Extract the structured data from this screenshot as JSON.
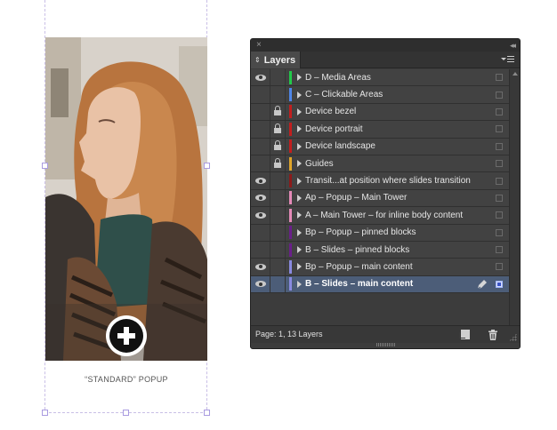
{
  "mockup": {
    "caption": "“STANDARD” POPUP",
    "button_icon": "plus-circle-icon"
  },
  "panel": {
    "close_icon": "×",
    "collapse_icon": "◂◂",
    "tab_label": "Layers",
    "status": "Page: 1, 13 Layers",
    "layers": [
      {
        "name": "D – Media Areas",
        "visible": true,
        "locked": false,
        "color": "#22c94a",
        "selected": false
      },
      {
        "name": "C – Clickable Areas",
        "visible": false,
        "locked": false,
        "color": "#4f86e8",
        "selected": false
      },
      {
        "name": "Device bezel",
        "visible": false,
        "locked": true,
        "color": "#c21e1e",
        "selected": false
      },
      {
        "name": "Device portrait",
        "visible": false,
        "locked": true,
        "color": "#c21e1e",
        "selected": false
      },
      {
        "name": "Device landscape",
        "visible": false,
        "locked": true,
        "color": "#c21e1e",
        "selected": false
      },
      {
        "name": "Guides",
        "visible": false,
        "locked": true,
        "color": "#e0a52a",
        "selected": false
      },
      {
        "name": "Transit...at position where slides transition",
        "visible": true,
        "locked": false,
        "color": "#8c1a1a",
        "selected": false
      },
      {
        "name": "Ap – Popup – Main Tower",
        "visible": true,
        "locked": false,
        "color": "#e58ab8",
        "selected": false
      },
      {
        "name": "A – Main Tower – for inline body content",
        "visible": true,
        "locked": false,
        "color": "#e58ab8",
        "selected": false
      },
      {
        "name": "Bp – Popup – pinned blocks",
        "visible": false,
        "locked": false,
        "color": "#6a1f8a",
        "selected": false
      },
      {
        "name": "B – Slides – pinned blocks",
        "visible": false,
        "locked": false,
        "color": "#6a1f8a",
        "selected": false
      },
      {
        "name": "Bp – Popup – main content",
        "visible": true,
        "locked": false,
        "color": "#8a8ae0",
        "selected": false
      },
      {
        "name": "B – Slides – main content",
        "visible": true,
        "locked": false,
        "color": "#8a8ae0",
        "selected": true
      }
    ]
  }
}
